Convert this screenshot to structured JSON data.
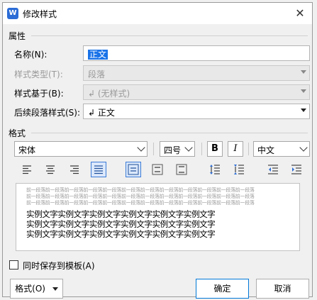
{
  "dialog": {
    "title": "修改样式",
    "app_icon_glyph": "W"
  },
  "properties": {
    "section_label": "属性",
    "name_label": "名称(N):",
    "name_value": "正文",
    "style_type_label": "样式类型(T):",
    "style_type_value": "段落",
    "based_on_label": "样式基于(B):",
    "based_on_value": "↲ (无样式)",
    "next_style_label": "后续段落样式(S):",
    "next_style_value": "↲ 正文"
  },
  "format": {
    "section_label": "格式",
    "font_value": "宋体",
    "size_value": "四号",
    "bold_label": "B",
    "italic_label": "I",
    "language_value": "中文"
  },
  "preview": {
    "grey_line_text": "前一段落前一段落前一段落前一段落前一段落前一段落前一段落前一段落前一段落前一段落前一段落前一段落",
    "sample_line_text": "实例文字实例文字实例文字实例文字实例文字实例文字"
  },
  "footer": {
    "save_to_template_label": "同时保存到模板(A)",
    "format_button_label": "格式(O)",
    "ok_label": "确定",
    "cancel_label": "取消"
  },
  "colors": {
    "accent": "#1a73e8",
    "selected_button_border": "#3c7bd6"
  }
}
